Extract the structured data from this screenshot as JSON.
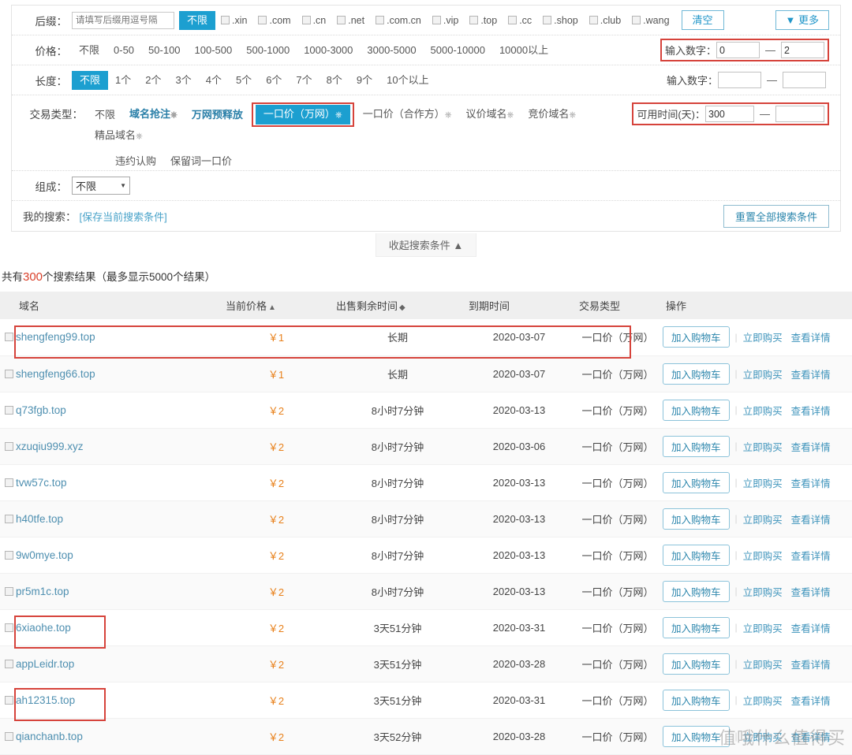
{
  "filters": {
    "suffix": {
      "label": "后缀：",
      "input_placeholder": "请填写后缀用逗号隔",
      "input_value": "",
      "unlimited": "不限",
      "tlds": [
        ".xin",
        ".com",
        ".cn",
        ".net",
        ".com.cn",
        ".vip",
        ".top",
        ".cc",
        ".shop",
        ".club",
        ".wang"
      ],
      "clear_label": "清空",
      "more_label": "▼ 更多"
    },
    "price": {
      "label": "价格：",
      "options": [
        "不限",
        "0-50",
        "50-100",
        "100-500",
        "500-1000",
        "1000-3000",
        "3000-5000",
        "5000-10000",
        "10000以上"
      ],
      "selected": "不限",
      "range_label": "输入数字：",
      "range_min": "0",
      "range_max": "2",
      "dash": "—"
    },
    "length": {
      "label": "长度：",
      "options": [
        "不限",
        "1个",
        "2个",
        "3个",
        "4个",
        "5个",
        "6个",
        "7个",
        "8个",
        "9个",
        "10个以上"
      ],
      "selected": "不限",
      "range_label": "输入数字：",
      "range_min": "",
      "range_max": "",
      "dash": "—"
    },
    "trade_type": {
      "label": "交易类型：",
      "options": [
        {
          "text": "不限",
          "style": "plain"
        },
        {
          "text": "域名抢注",
          "style": "link",
          "help": "?"
        },
        {
          "text": "万网预释放",
          "style": "link"
        },
        {
          "text": "一口价（万网）",
          "style": "selected",
          "help": "?"
        },
        {
          "text": "一口价（合作方）",
          "style": "plain",
          "help": "?"
        },
        {
          "text": "议价域名",
          "style": "plain",
          "help": "?"
        },
        {
          "text": "竞价域名",
          "style": "plain",
          "help": "?"
        },
        {
          "text": "精品域名",
          "style": "plain",
          "help": "?"
        }
      ],
      "options_row2": [
        {
          "text": "违约认购",
          "style": "plain"
        },
        {
          "text": "保留词一口价",
          "style": "plain"
        }
      ],
      "time_label": "可用时间(天)：",
      "time_min": "300",
      "time_max": "",
      "dash": "—"
    },
    "composition": {
      "label": "组成：",
      "selected": "不限",
      "options": [
        "不限"
      ]
    },
    "my_search": {
      "label": "我的搜索：",
      "save_link": "[保存当前搜索条件]",
      "reset_label": "重置全部搜索条件"
    },
    "collapse_label": "收起搜索条件 ▲"
  },
  "result_summary": {
    "prefix": "共有",
    "count": "300",
    "middle": "个搜索结果（最多显示5000个结果）"
  },
  "table": {
    "columns": [
      "域名",
      "当前价格",
      "出售剩余时间",
      "到期时间",
      "交易类型",
      "操作"
    ],
    "sort_icons": {
      "price": "▲",
      "remaining": "◆"
    },
    "actions": {
      "cart": "加入购物车",
      "buy_now": "立即购买",
      "details": "查看详情"
    },
    "rows": [
      {
        "domain": "shengfeng99.top",
        "price": "￥1",
        "remaining": "长期",
        "expire": "2020-03-07",
        "type": "一口价（万网）",
        "highlighted": true
      },
      {
        "domain": "shengfeng66.top",
        "price": "￥1",
        "remaining": "长期",
        "expire": "2020-03-07",
        "type": "一口价（万网）",
        "highlighted": false
      },
      {
        "domain": "q73fgb.top",
        "price": "￥2",
        "remaining": "8小时7分钟",
        "expire": "2020-03-13",
        "type": "一口价（万网）",
        "highlighted": false
      },
      {
        "domain": "xzuqiu999.xyz",
        "price": "￥2",
        "remaining": "8小时7分钟",
        "expire": "2020-03-06",
        "type": "一口价（万网）",
        "highlighted": false
      },
      {
        "domain": "tvw57c.top",
        "price": "￥2",
        "remaining": "8小时7分钟",
        "expire": "2020-03-13",
        "type": "一口价（万网）",
        "highlighted": false
      },
      {
        "domain": "h40tfe.top",
        "price": "￥2",
        "remaining": "8小时7分钟",
        "expire": "2020-03-13",
        "type": "一口价（万网）",
        "highlighted": false
      },
      {
        "domain": "9w0mye.top",
        "price": "￥2",
        "remaining": "8小时7分钟",
        "expire": "2020-03-13",
        "type": "一口价（万网）",
        "highlighted": false
      },
      {
        "domain": "pr5m1c.top",
        "price": "￥2",
        "remaining": "8小时7分钟",
        "expire": "2020-03-13",
        "type": "一口价（万网）",
        "highlighted": false
      },
      {
        "domain": "6xiaohe.top",
        "price": "￥2",
        "remaining": "3天51分钟",
        "expire": "2020-03-31",
        "type": "一口价（万网）",
        "highlighted": true
      },
      {
        "domain": "appLeidr.top",
        "price": "￥2",
        "remaining": "3天51分钟",
        "expire": "2020-03-28",
        "type": "一口价（万网）",
        "highlighted": false
      },
      {
        "domain": "ah12315.top",
        "price": "￥2",
        "remaining": "3天51分钟",
        "expire": "2020-03-31",
        "type": "一口价（万网）",
        "highlighted": true
      },
      {
        "domain": "qianchanb.top",
        "price": "￥2",
        "remaining": "3天52分钟",
        "expire": "2020-03-28",
        "type": "一口价（万网）",
        "highlighted": false
      }
    ]
  },
  "watermark": "值哦什么值得买",
  "colors": {
    "accent": "#1c9fd0",
    "link": "#3d93bb",
    "price": "#e8801a",
    "highlight": "#d6433b",
    "count": "#d9402a"
  }
}
